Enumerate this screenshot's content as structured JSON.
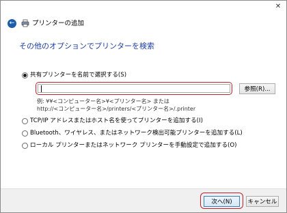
{
  "window": {
    "title": "プリンターの追加",
    "close_glyph": "✕",
    "back_glyph": "←"
  },
  "main": {
    "heading": "その他のオプションでプリンターを検索",
    "options": [
      {
        "label": "共有プリンターを名前で選択する(S)",
        "selected": true
      },
      {
        "label": "TCP/IP アドレスまたはホスト名を使ってプリンターを追加する(I)",
        "selected": false
      },
      {
        "label": "Bluetooth、ワイヤレス、またはネットワーク検出可能プリンターを追加する(L)",
        "selected": false
      },
      {
        "label": "ローカル プリンターまたはネットワーク プリンターを手動設定で追加する(O)",
        "selected": false
      }
    ],
    "printer_path": {
      "value": "",
      "placeholder": ""
    },
    "browse_label": "参照(R)...",
    "example_line1": "例: ¥¥<コンピューター名>¥<プリンター名> または",
    "example_line2": "http://<コンピューター名>/printers/<プリンター名>/.printer"
  },
  "footer": {
    "next_label": "次へ(N)",
    "cancel_label": "キャンセル"
  },
  "colors": {
    "heading": "#1d3fa0",
    "highlight": "#c0202a",
    "back_button": "#1c5ea8",
    "footer_bg": "#f0f0f0"
  },
  "icons": {
    "back": "arrow-left-icon",
    "printer": "printer-icon",
    "close": "close-icon"
  }
}
